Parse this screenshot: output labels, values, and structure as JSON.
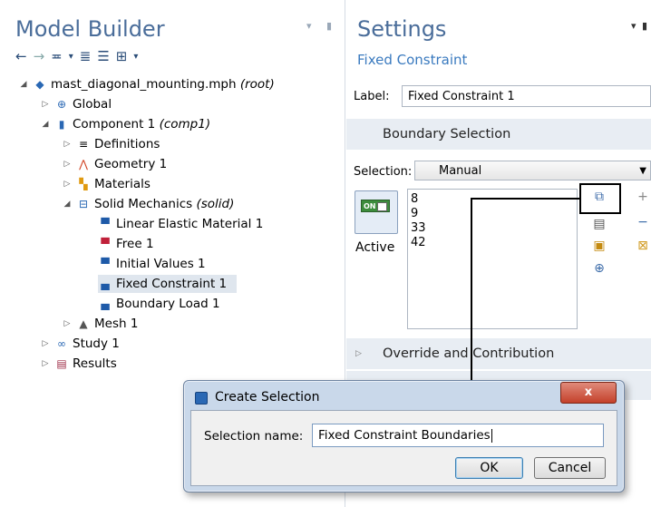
{
  "model_builder": {
    "title": "Model Builder",
    "tree": [
      {
        "label": "mast_diagonal_mounting.mph",
        "suffix": "(root)",
        "icon": "root-icon"
      },
      {
        "label": "Global",
        "suffix": "",
        "icon": "globe-icon"
      },
      {
        "label": "Component 1",
        "suffix": "(comp1)",
        "icon": "component-icon"
      },
      {
        "label": "Definitions",
        "suffix": "",
        "icon": "definitions-icon"
      },
      {
        "label": "Geometry 1",
        "suffix": "",
        "icon": "geometry-icon"
      },
      {
        "label": "Materials",
        "suffix": "",
        "icon": "materials-icon"
      },
      {
        "label": "Solid Mechanics",
        "suffix": "(solid)",
        "icon": "solid-mechanics-icon"
      },
      {
        "label": "Linear Elastic Material 1",
        "suffix": "",
        "icon": "material-node-icon"
      },
      {
        "label": "Free 1",
        "suffix": "",
        "icon": "free-icon"
      },
      {
        "label": "Initial Values 1",
        "suffix": "",
        "icon": "initial-values-icon"
      },
      {
        "label": "Fixed Constraint 1",
        "suffix": "",
        "icon": "boundary-node-icon"
      },
      {
        "label": "Boundary Load 1",
        "suffix": "",
        "icon": "boundary-node-icon"
      },
      {
        "label": "Mesh 1",
        "suffix": "",
        "icon": "mesh-icon"
      },
      {
        "label": "Study 1",
        "suffix": "",
        "icon": "study-icon"
      },
      {
        "label": "Results",
        "suffix": "",
        "icon": "results-icon"
      }
    ]
  },
  "settings": {
    "title": "Settings",
    "subtitle": "Fixed Constraint",
    "label_caption": "Label:",
    "label_value": "Fixed Constraint 1",
    "boundary_section": "Boundary Selection",
    "selection_caption": "Selection:",
    "selection_value": "Manual",
    "toggle_text": "ON",
    "active_label": "Active",
    "boundaries": [
      "8",
      "9",
      "33",
      "42"
    ],
    "override_section": "Override and Contribution"
  },
  "dialog": {
    "title": "Create Selection",
    "close_label": "x",
    "field_label": "Selection name:",
    "field_value": "Fixed Constraint Boundaries",
    "ok_label": "OK",
    "cancel_label": "Cancel"
  }
}
